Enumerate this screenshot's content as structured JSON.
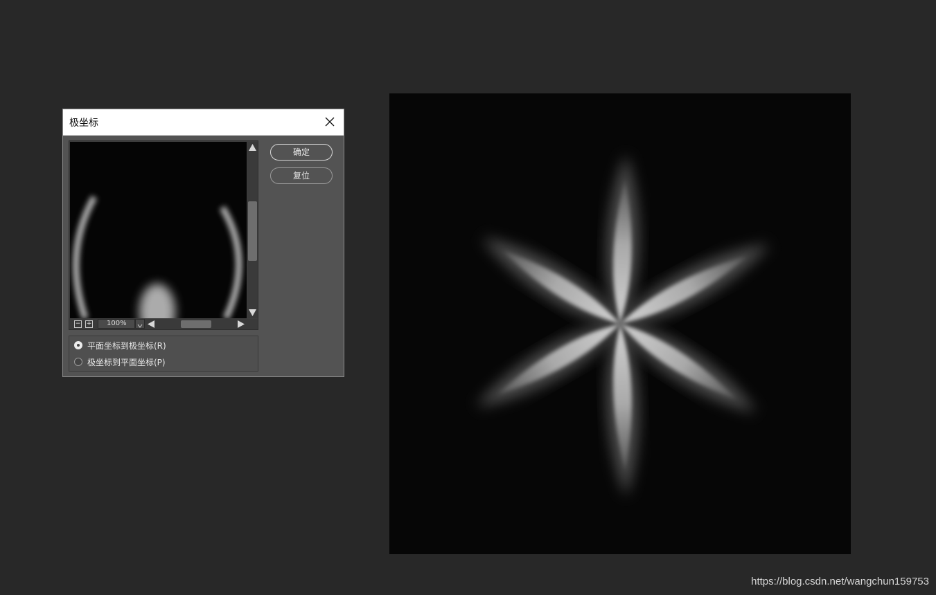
{
  "dialog": {
    "title": "极坐标",
    "ok_label": "确定",
    "reset_label": "复位",
    "zoom": {
      "value": "100%",
      "zoom_out_glyph": "−",
      "zoom_in_glyph": "+"
    },
    "options": [
      {
        "label": "平面坐标到极坐标(R)",
        "checked": true
      },
      {
        "label": "极坐标到平面坐标(P)",
        "checked": false
      }
    ],
    "icons": {
      "close": "close-icon",
      "scroll_up": "triangle-up-icon",
      "scroll_down": "triangle-down-icon",
      "scroll_left": "triangle-left-icon",
      "scroll_right": "triangle-right-icon",
      "zoom_dropdown": "chevron-down-icon"
    }
  },
  "canvas": {
    "petal_count": 6
  },
  "watermark": "https://blog.csdn.net/wangchun159753",
  "colors": {
    "app_background": "#282828",
    "dialog_background": "#535353",
    "canvas_background": "#060606",
    "petal_core": "#bdbdbd"
  }
}
